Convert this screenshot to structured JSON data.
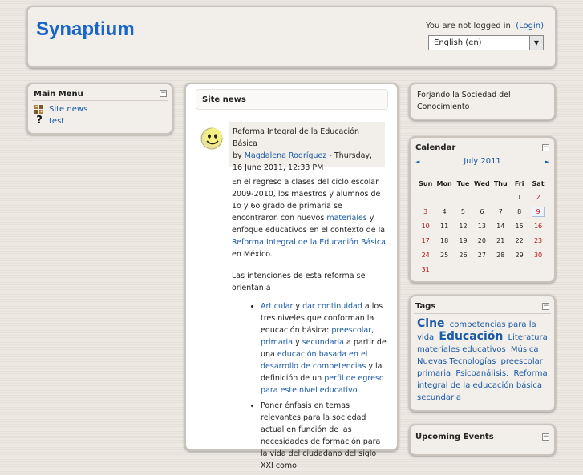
{
  "header": {
    "site_name": "Synaptium",
    "login_text": "You are not logged in.",
    "login_link": "(Login)",
    "language_selected": "English (en)"
  },
  "main_menu": {
    "title": "Main Menu",
    "items": [
      {
        "label": "Site news",
        "icon": "forum-icon"
      },
      {
        "label": "test",
        "icon": "question-icon"
      }
    ]
  },
  "site_news": {
    "title": "Site news",
    "post": {
      "subject": "Reforma Integral de la Educación Básica",
      "by": "by",
      "author": "Magdalena Rodríguez",
      "date": "- Thursday, 16 June 2011, 12:33 PM",
      "p1_a": "En el regreso a clases del ciclo escolar 2009-2010, los maestros y alumnos de 1o y 6o grado de primaria se encontraron con nuevos",
      "p1_link1": "materiales",
      "p1_b": "y enfoque educativos en el contexto de la",
      "p1_link2": "Reforma Integral de la Educación Básica",
      "p1_c": "en México.",
      "p2": "Las intenciones de esta reforma se orientan a",
      "b1_link1": "Articular",
      "b1_t1": "y",
      "b1_link2": "dar continuidad",
      "b1_t2": "a los tres niveles que conforman la educación básica:",
      "b1_link3": "preescolar",
      "b1_t3": ",",
      "b1_link4": "primaria",
      "b1_t4": "y",
      "b1_link5": "secundaria",
      "b1_t5": "a partir de una",
      "b1_link6": "educación basada en el desarrollo de competencias",
      "b1_t6": "y la definición de un",
      "b1_link7": "perfil de egreso para este nivel educativo",
      "b2": "Poner énfasis en temas relevantes para la sociedad actual en función de las necesidades de formación para la vida del ciudadano del siglo XXI como"
    }
  },
  "forjando": {
    "text": "Forjando la Sociedad del Conocimiento"
  },
  "calendar": {
    "title": "Calendar",
    "month": "July 2011",
    "prev": "◄",
    "next": "►",
    "weekdays": [
      "Sun",
      "Mon",
      "Tue",
      "Wed",
      "Thu",
      "Fri",
      "Sat"
    ],
    "weeks": [
      [
        "",
        "",
        "",
        "",
        "",
        "1",
        "2"
      ],
      [
        "3",
        "4",
        "5",
        "6",
        "7",
        "8",
        "9"
      ],
      [
        "10",
        "11",
        "12",
        "13",
        "14",
        "15",
        "16"
      ],
      [
        "17",
        "18",
        "19",
        "20",
        "21",
        "22",
        "23"
      ],
      [
        "24",
        "25",
        "26",
        "27",
        "28",
        "29",
        "30"
      ],
      [
        "31",
        "",
        "",
        "",
        "",
        "",
        ""
      ]
    ],
    "today": "9"
  },
  "tags": {
    "title": "Tags",
    "items": [
      {
        "label": "Cine",
        "big": true
      },
      {
        "label": "competencias para la vida",
        "big": false
      },
      {
        "label": "Educación",
        "big": true
      },
      {
        "label": "Literatura",
        "big": false
      },
      {
        "label": "materiales educativos",
        "big": false
      },
      {
        "label": "Música",
        "big": false
      },
      {
        "label": "Nuevas Tecnologías",
        "big": false
      },
      {
        "label": "preescolar",
        "big": false
      },
      {
        "label": "primaria",
        "big": false
      },
      {
        "label": "Psicoanálisis.",
        "big": false
      },
      {
        "label": "Reforma integral de la educación básica",
        "big": false
      },
      {
        "label": "secundaria",
        "big": false
      }
    ]
  },
  "upcoming": {
    "title": "Upcoming Events"
  },
  "colors": {
    "accent": "#1a64c8",
    "link": "#1a5aa6",
    "weekend": "#b31212"
  }
}
